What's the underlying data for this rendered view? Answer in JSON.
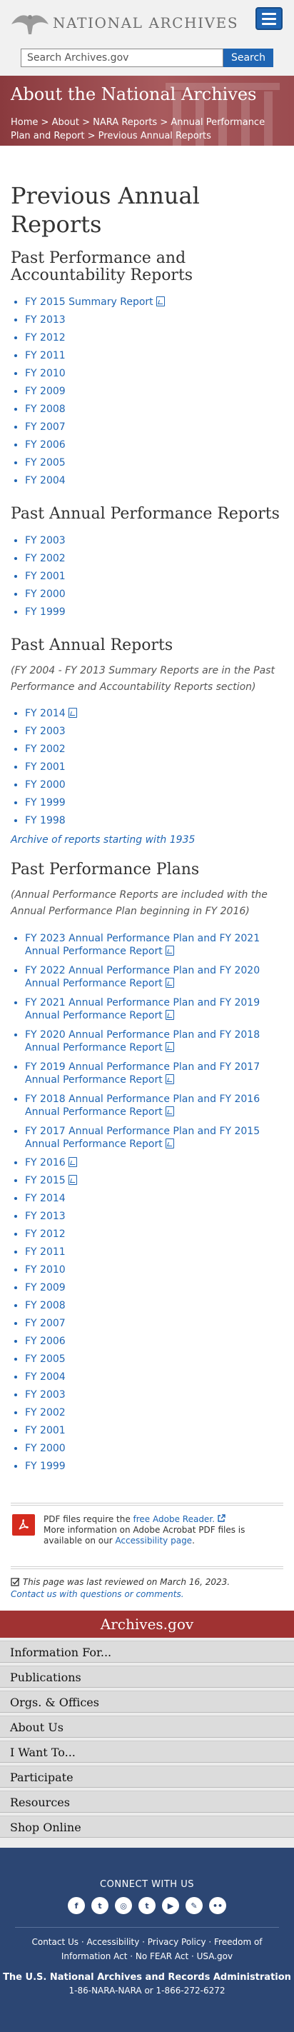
{
  "header": {
    "wordmark": "NATIONAL ARCHIVES",
    "search_placeholder": "Search Archives.gov",
    "search_button": "Search"
  },
  "hero": {
    "title": "About the National Archives",
    "breadcrumbs": [
      "Home",
      "About",
      "NARA Reports",
      "Annual Performance Plan and Report",
      "Previous Annual Reports"
    ],
    "separator": " > "
  },
  "main": {
    "page_title": "Previous Annual Reports",
    "par": {
      "heading": "Past Performance and Accountability Reports",
      "items": [
        "FY 2015 Summary Report",
        "FY 2013",
        "FY 2012",
        "FY 2011",
        "FY 2010",
        "FY 2009",
        "FY 2008",
        "FY 2007",
        "FY 2006",
        "FY 2005",
        "FY 2004"
      ]
    },
    "apr": {
      "heading": "Past Annual Performance Reports",
      "items": [
        "FY 2003",
        "FY 2002",
        "FY 2001",
        "FY 2000",
        "FY 1999"
      ]
    },
    "ar": {
      "heading": "Past Annual Reports",
      "note": "(FY 2004 - FY 2013 Summary Reports are in the Past Performance and Accountability Reports section)",
      "items": [
        "FY 2014",
        "FY 2003",
        "FY 2002",
        "FY 2001",
        "FY 2000",
        "FY 1999",
        "FY 1998"
      ],
      "archive_link": "Archive of reports starting with 1935"
    },
    "pp": {
      "heading": "Past Performance Plans",
      "note": "(Annual Performance Reports are included with the Annual Performance Plan beginning in FY 2016)",
      "items": [
        "FY 2023 Annual Performance Plan and FY 2021 Annual Performance Report",
        "FY 2022 Annual Performance Plan and FY 2020 Annual Performance Report",
        "FY 2021 Annual Performance Plan and FY 2019 Annual Performance Report",
        "FY 2020 Annual Performance Plan and FY 2018 Annual Performance Report",
        "FY 2019 Annual Performance Plan and FY 2017 Annual Performance Report",
        "FY 2018 Annual Performance Plan and FY 2016 Annual Performance Report",
        "FY 2017 Annual Performance Plan and FY 2015 Annual Performance Report",
        "FY 2016",
        "FY 2015",
        "FY 2014",
        "FY 2013",
        "FY 2012",
        "FY 2011",
        "FY 2010",
        "FY 2009",
        "FY 2008",
        "FY 2007",
        "FY 2006",
        "FY 2005",
        "FY 2004",
        "FY 2003",
        "FY 2002",
        "FY 2001",
        "FY 2000",
        "FY 1999"
      ]
    },
    "pdf_notice": {
      "text_before": "PDF files require the ",
      "reader_link": "free Adobe Reader.",
      "more_before": "More information on Adobe Acrobat PDF files is available on our ",
      "accessibility_link": "Accessibility page",
      "more_after": "."
    },
    "review": {
      "text": "This page was last reviewed on March 16, 2023.",
      "contact": "Contact us with questions or comments."
    }
  },
  "footer": {
    "banner": "Archives.gov",
    "nav": [
      "Information For...",
      "Publications",
      "Orgs. & Offices",
      "About Us",
      "I Want To...",
      "Participate",
      "Resources",
      "Shop Online"
    ],
    "connect": "CONNECT WITH US",
    "links": [
      "Contact Us",
      "Accessibility",
      "Privacy Policy",
      "Freedom of Information Act",
      "No FEAR Act",
      "USA.gov"
    ],
    "agency": "The U.S. National Archives and Records Administration",
    "phone": "1-86-NARA-NARA or 1-866-272-6272"
  }
}
